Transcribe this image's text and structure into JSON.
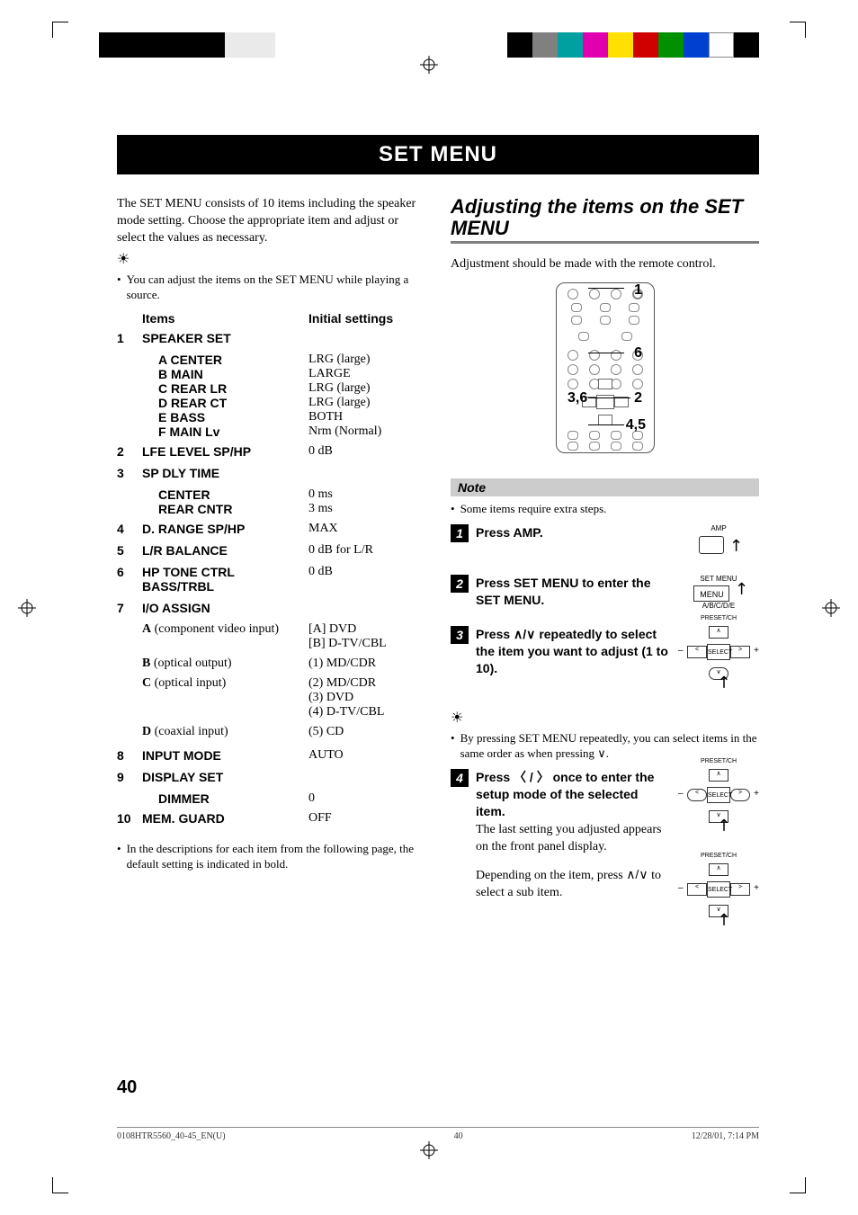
{
  "title": "SET MENU",
  "intro": "The SET MENU consists of 10 items including the speaker mode setting. Choose the appropriate item and adjust or select the values as necessary.",
  "intro_note": "You can adjust the items on the SET MENU while playing a source.",
  "table": {
    "header_items": "Items",
    "header_initial": "Initial settings",
    "rows": [
      {
        "num": "1",
        "name": "SPEAKER SET",
        "val": "",
        "subs": [
          {
            "name": "A CENTER",
            "val": "LRG (large)"
          },
          {
            "name": "B MAIN",
            "val": "LARGE"
          },
          {
            "name": "C REAR LR",
            "val": "LRG (large)"
          },
          {
            "name": "D REAR CT",
            "val": "LRG (large)"
          },
          {
            "name": "E BASS",
            "val": "BOTH"
          },
          {
            "name": "F MAIN Lv",
            "val": "Nrm (Normal)"
          }
        ]
      },
      {
        "num": "2",
        "name": "LFE LEVEL SP/HP",
        "val": "0 dB"
      },
      {
        "num": "3",
        "name": "SP DLY TIME",
        "val": "",
        "subs": [
          {
            "name": "CENTER",
            "val": "0 ms"
          },
          {
            "name": "REAR CNTR",
            "val": "3 ms"
          }
        ]
      },
      {
        "num": "4",
        "name": "D. RANGE SP/HP",
        "val": "MAX"
      },
      {
        "num": "5",
        "name": "L/R BALANCE",
        "val": "0 dB for L/R"
      },
      {
        "num": "6",
        "name": "HP TONE CTRL BASS/TRBL",
        "val": "0 dB"
      },
      {
        "num": "7",
        "name": "I/O ASSIGN",
        "val": "",
        "plain": [
          {
            "label": "A (component video input)",
            "lead": "A",
            "vals": "[A] DVD\n[B] D-TV/CBL"
          },
          {
            "label": "B (optical output)",
            "lead": "B",
            "vals": "(1) MD/CDR"
          },
          {
            "label": "C (optical input)",
            "lead": "C",
            "vals": "(2) MD/CDR\n(3) DVD\n(4) D-TV/CBL"
          },
          {
            "label": "D (coaxial input)",
            "lead": "D",
            "vals": "(5) CD"
          }
        ]
      },
      {
        "num": "8",
        "name": "INPUT MODE",
        "val": "AUTO"
      },
      {
        "num": "9",
        "name": "DISPLAY SET",
        "val": "",
        "subs": [
          {
            "name": "DIMMER",
            "val": "0"
          }
        ]
      },
      {
        "num": "10",
        "name": "MEM. GUARD",
        "val": "OFF"
      }
    ]
  },
  "left_footnote": "In the descriptions for each item from the following page, the default setting is indicated in bold.",
  "right": {
    "heading": "Adjusting the items on the SET MENU",
    "intro": "Adjustment should be made with the remote control.",
    "callouts": {
      "c1": "1",
      "c6": "6",
      "c2": "2",
      "c45": "4,5",
      "c36": "3,6"
    },
    "note_label": "Note",
    "note_text": "Some items require extra steps.",
    "steps": {
      "s1": "Press AMP.",
      "s1_icon_label": "AMP",
      "s2": "Press SET MENU to enter the SET MENU.",
      "s2_top": "SET MENU",
      "s2_btn": "MENU",
      "s2_sub": "A/B/C/D/E",
      "s3_a": "Press ",
      "s3_b": " repeatedly to select the item you want to adjust (1 to 10).",
      "s3_dpad_top": "PRESET/CH",
      "s3_dpad_center": "SELECT",
      "tip": "By pressing SET MENU repeatedly, you can select items in the same order as when pressing ",
      "s4_a": "Press ",
      "s4_b": " once to enter the setup mode of the selected item.",
      "s4_plain": "The last setting you adjusted appears on the front panel display.",
      "s4_extra_a": "Depending on the item, press ",
      "s4_extra_b": " to select a sub item."
    }
  },
  "page_number": "40",
  "footer": {
    "left": "0108HTR5560_40-45_EN(U)",
    "center": "40",
    "right": "12/28/01, 7:14 PM"
  },
  "color_bar_right": [
    "#000000",
    "#808080",
    "#00a0a0",
    "#e000b0",
    "#ffe000",
    "#d00000",
    "#009000",
    "#0040d0",
    "#ffffff",
    "#000000"
  ]
}
